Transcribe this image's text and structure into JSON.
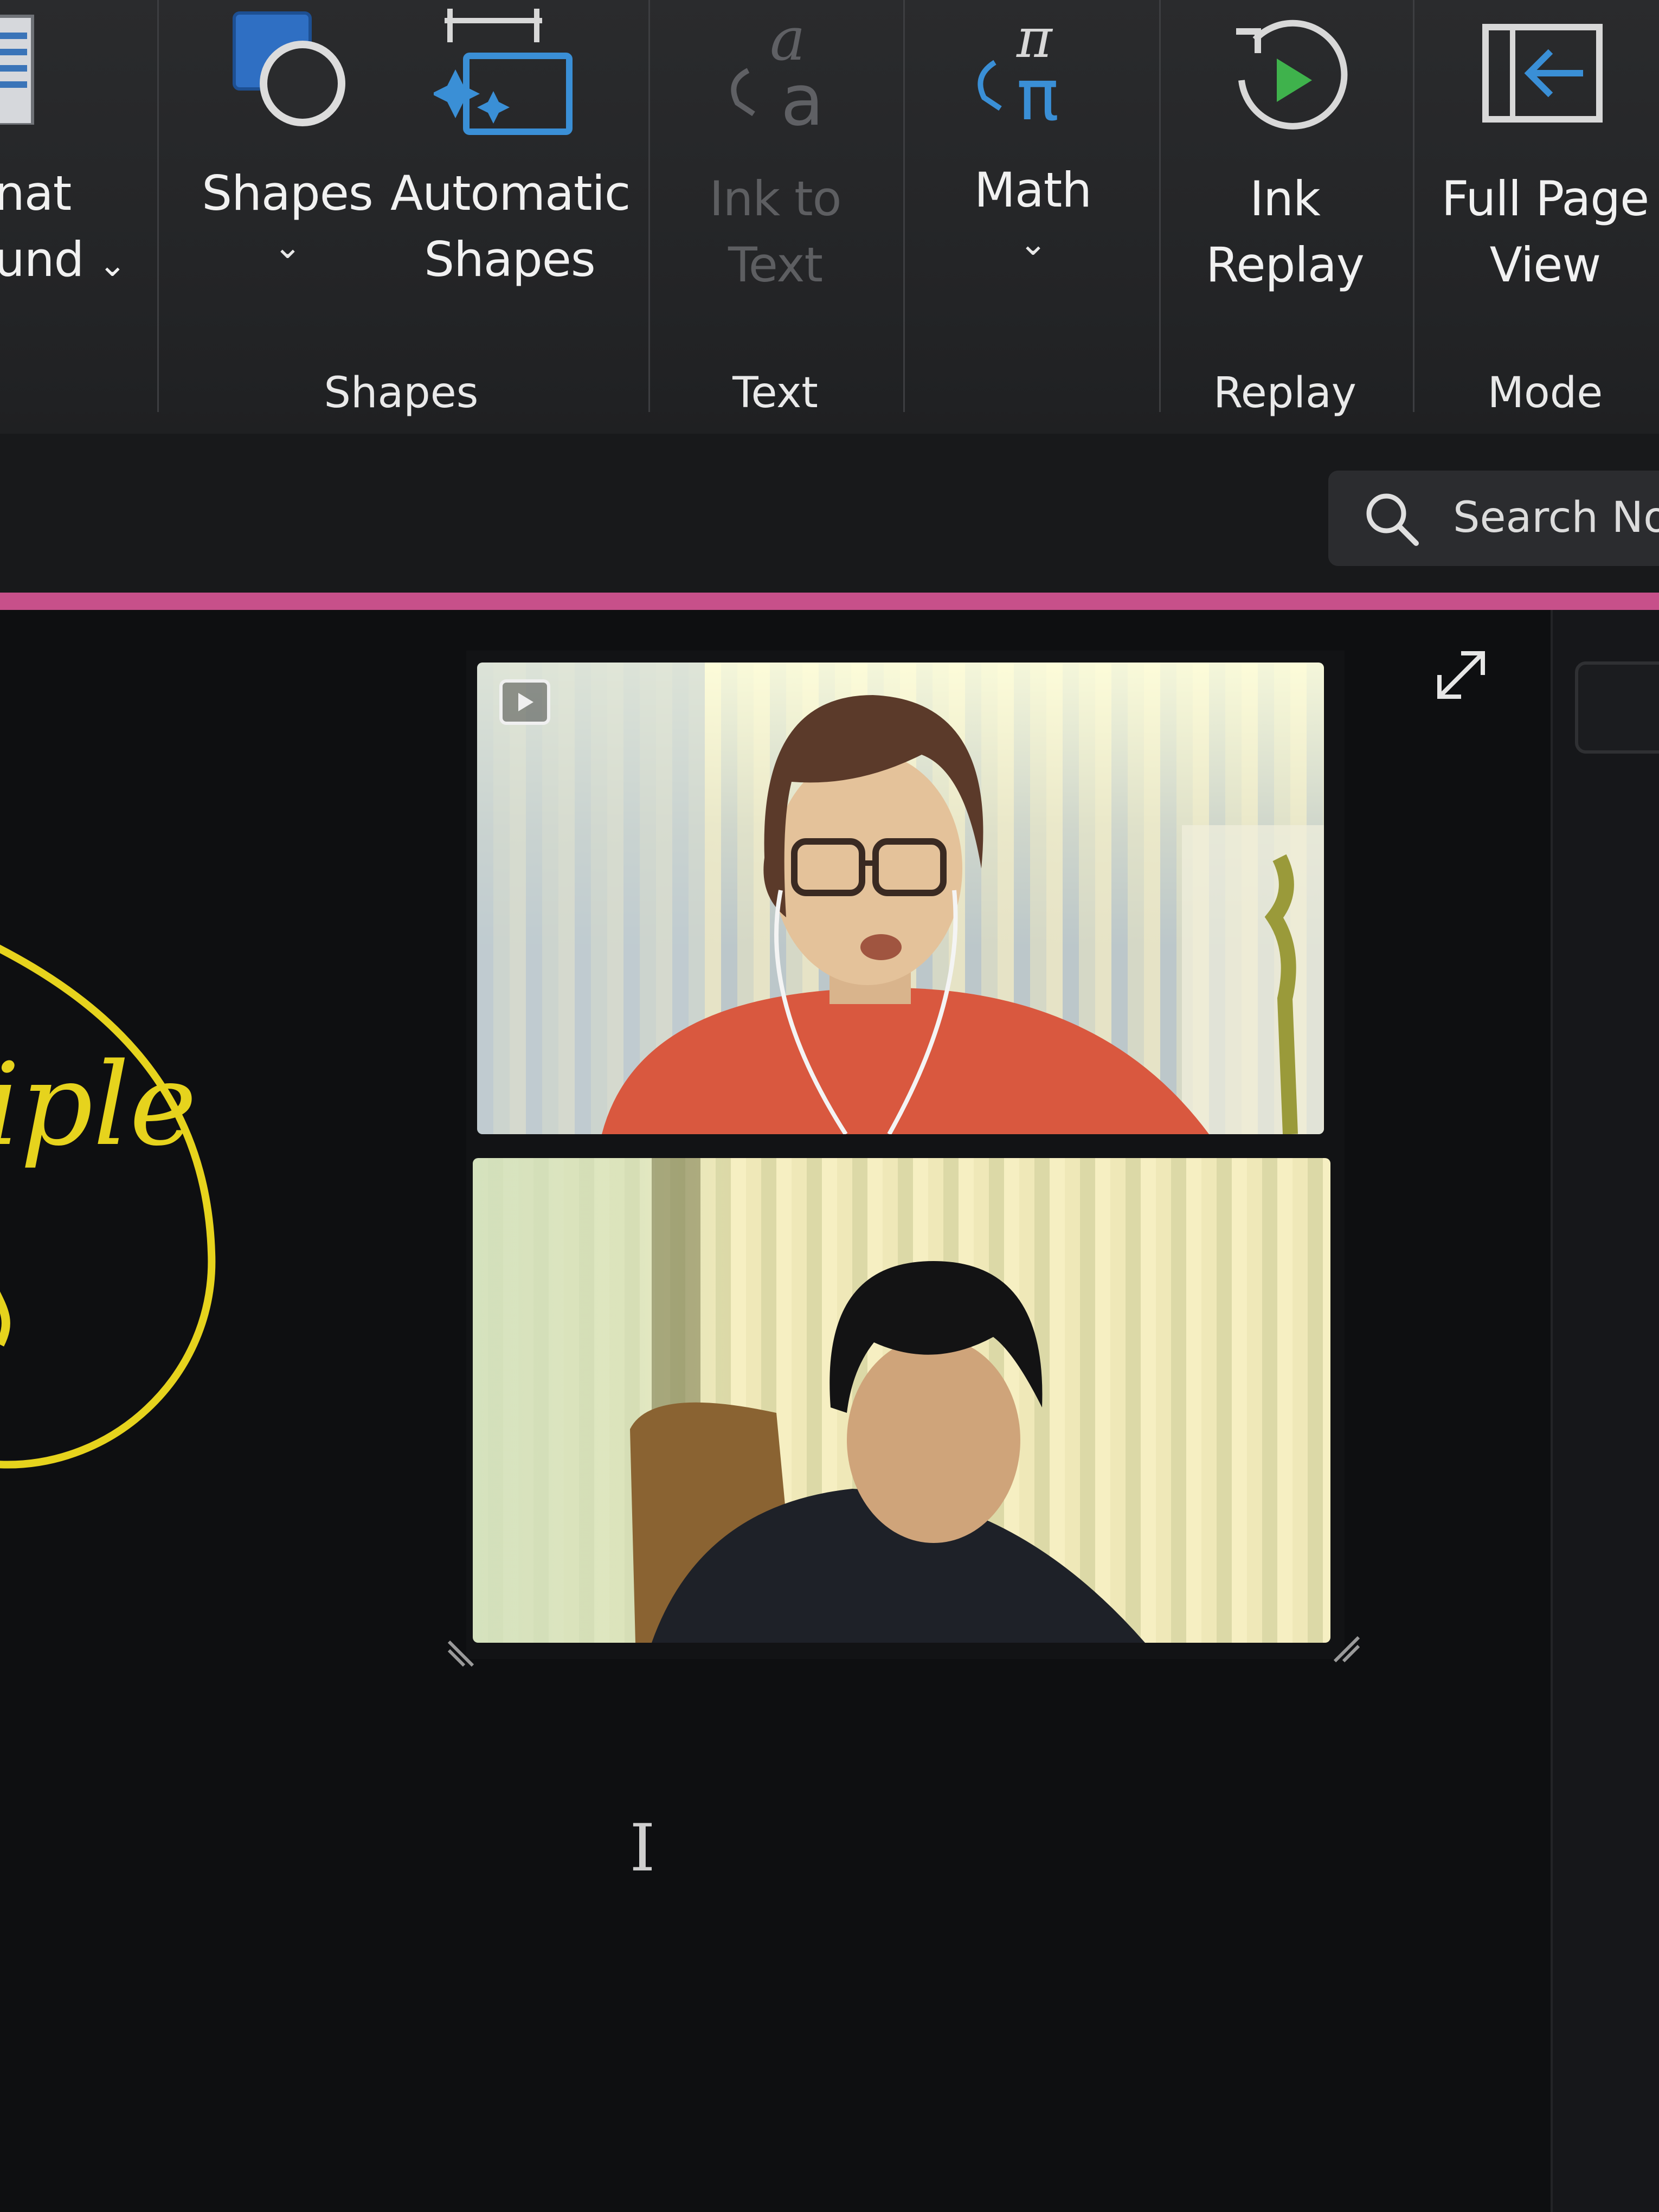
{
  "ribbon": {
    "partial_button": {
      "line1": "nat",
      "line2": "und"
    },
    "shapes_button": {
      "label": "Shapes"
    },
    "automatic_shapes_button": {
      "line1": "Automatic",
      "line2": "Shapes"
    },
    "ink_to_text_button": {
      "line1": "Ink to",
      "line2": "Text"
    },
    "math_button": {
      "label": "Math"
    },
    "ink_replay_button": {
      "line1": "Ink",
      "line2": "Replay"
    },
    "full_page_view_button": {
      "line1": "Full Page",
      "line2": "View"
    },
    "groups": {
      "shapes": "Shapes",
      "text": "Text",
      "replay": "Replay",
      "mode": "Mode"
    },
    "chevron": "⌄"
  },
  "search": {
    "text": "Search Not"
  },
  "canvas": {
    "ink_text": "iple",
    "ink_color": "#e6d31d",
    "cursor": "I"
  },
  "colors": {
    "section_accent": "#c7508a",
    "ribbon_icon_blue": "#3a8fd6"
  },
  "video": {
    "participants": [
      {
        "name": "",
        "shirt": "red"
      },
      {
        "name": "",
        "shirt": "dark"
      }
    ]
  },
  "icons": {
    "search": "search-icon",
    "expand": "expand-icon",
    "video_badge": "video-icon"
  }
}
